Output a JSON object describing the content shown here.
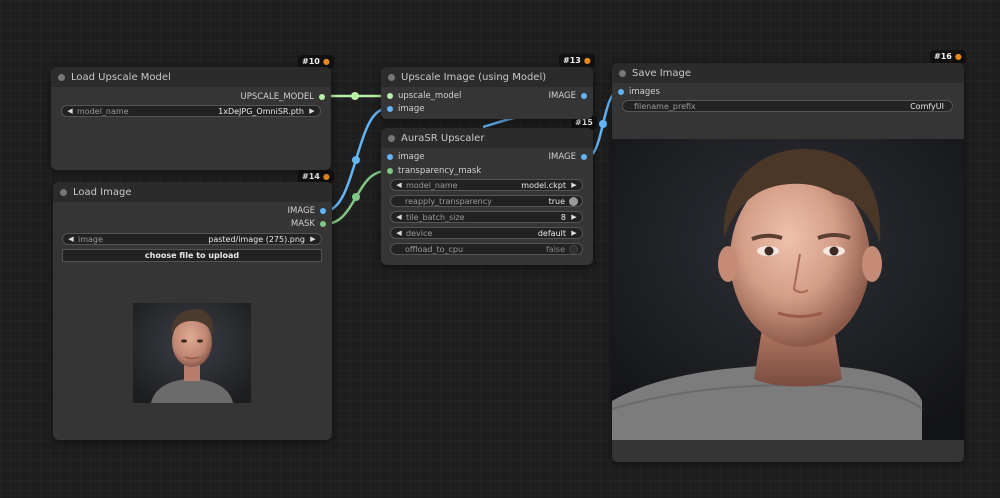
{
  "colors": {
    "canvas": "#1e1e1e",
    "node_body": "#353535",
    "node_title": "#2b2b2b",
    "model_link": "#b9f0a8",
    "image_link": "#64b5f6",
    "mask_link": "#81c784"
  },
  "nodes": {
    "load_upscale_model": {
      "title": "Load Upscale Model",
      "badge": "#10",
      "outputs": [
        {
          "label": "UPSCALE_MODEL"
        }
      ],
      "widgets": [
        {
          "label": "model_name",
          "value": "1xDeJPG_OmniSR.pth"
        }
      ]
    },
    "load_image": {
      "title": "Load Image",
      "badge": "#14",
      "outputs": [
        {
          "label": "IMAGE"
        },
        {
          "label": "MASK"
        }
      ],
      "widgets": [
        {
          "label": "image",
          "value": "pasted/image (275).png"
        }
      ],
      "upload_button": "choose file to upload"
    },
    "upscale_image": {
      "title": "Upscale Image (using Model)",
      "badge": "#13",
      "inputs": [
        {
          "label": "upscale_model"
        },
        {
          "label": "image"
        }
      ],
      "outputs": [
        {
          "label": "IMAGE"
        }
      ]
    },
    "aurasr": {
      "title": "AuraSR Upscaler",
      "badge": "#15",
      "inputs": [
        {
          "label": "image"
        },
        {
          "label": "transparency_mask"
        }
      ],
      "outputs": [
        {
          "label": "IMAGE"
        }
      ],
      "widgets": [
        {
          "label": "model_name",
          "value": "model.ckpt"
        },
        {
          "label": "reapply_transparency",
          "value": "true"
        },
        {
          "label": "tile_batch_size",
          "value": "8"
        },
        {
          "label": "device",
          "value": "default"
        },
        {
          "label": "offload_to_cpu",
          "value": "false"
        }
      ]
    },
    "save_image": {
      "title": "Save Image",
      "badge": "#16",
      "inputs": [
        {
          "label": "images"
        }
      ],
      "widgets": [
        {
          "label": "filename_prefix",
          "value": "ComfyUI"
        }
      ]
    }
  }
}
